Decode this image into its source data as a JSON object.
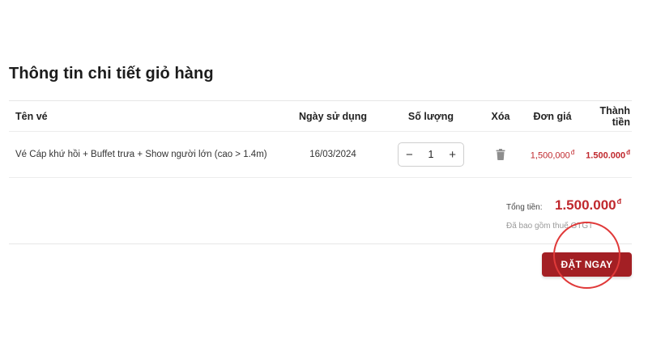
{
  "page": {
    "title": "Thông tin chi tiết giỏ hàng"
  },
  "table": {
    "headers": {
      "name": "Tên vé",
      "date": "Ngày sử dụng",
      "qty": "Số lượng",
      "delete": "Xóa",
      "unit_price": "Đơn giá",
      "total": "Thành tiền"
    },
    "rows": [
      {
        "name": "Vé Cáp khứ hồi + Buffet trưa + Show người lớn (cao > 1.4m)",
        "date": "16/03/2024",
        "qty": "1",
        "qty_minus": "−",
        "qty_plus": "+",
        "delete_icon": "trash-icon",
        "unit_price": "1,500,000",
        "total": "1.500.000",
        "currency": "đ"
      }
    ]
  },
  "summary": {
    "label": "Tổng tiền:",
    "value": "1.500.000",
    "currency": "đ",
    "vat_note": "Đã bao gồm thuế GTGT"
  },
  "actions": {
    "book_now": "ĐẶT NGAY"
  },
  "colors": {
    "accent": "#a31f24",
    "price": "#c0282d",
    "highlight": "#e03a3a"
  }
}
